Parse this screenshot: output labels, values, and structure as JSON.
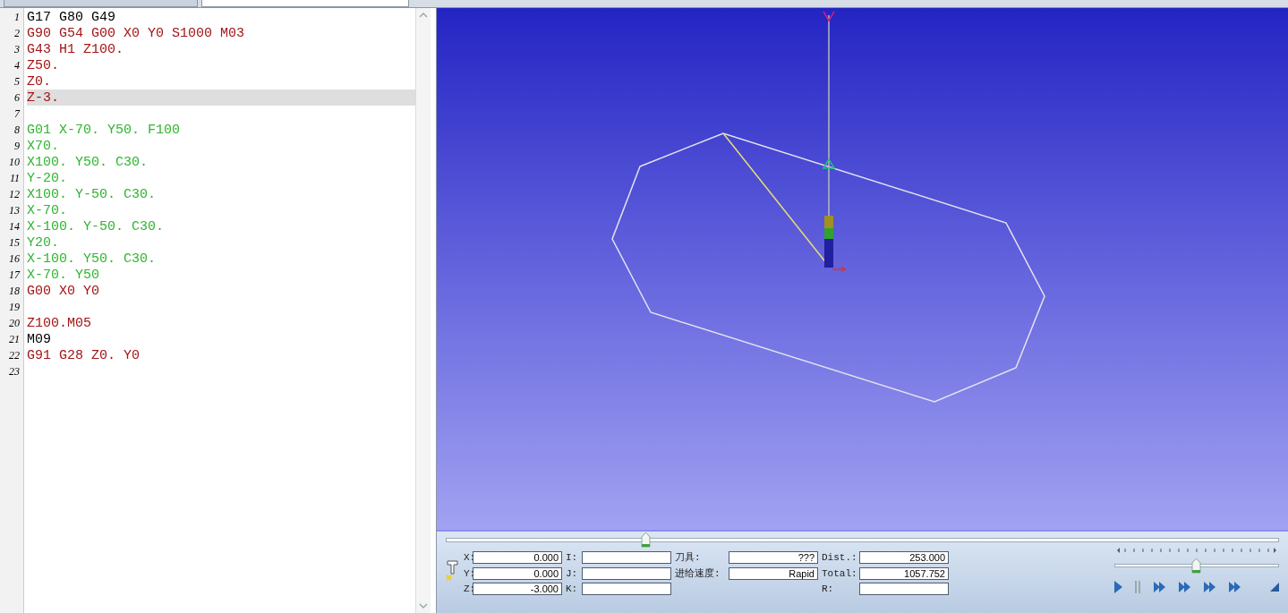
{
  "editor": {
    "lines": [
      {
        "number": "1",
        "text": "G17 G80 G49",
        "kind": "plain",
        "selected": false
      },
      {
        "number": "2",
        "text": "G90 G54 G00 X0 Y0 S1000 M03",
        "kind": "rapid",
        "selected": false
      },
      {
        "number": "3",
        "text": "G43 H1 Z100.",
        "kind": "rapid",
        "selected": false
      },
      {
        "number": "4",
        "text": "Z50.",
        "kind": "rapid",
        "selected": false
      },
      {
        "number": "5",
        "text": "Z0.",
        "kind": "rapid",
        "selected": false
      },
      {
        "number": "6",
        "text": "Z-3.",
        "kind": "rapid",
        "selected": true
      },
      {
        "number": "7",
        "kind": "plain",
        "selected": false
      },
      {
        "number": "8",
        "text": "G01 X-70. Y50. F100",
        "kind": "feed",
        "selected": false
      },
      {
        "number": "9",
        "text": "X70.",
        "kind": "feed",
        "selected": false
      },
      {
        "number": "10",
        "text": "X100. Y50. C30.",
        "kind": "feed",
        "selected": false
      },
      {
        "number": "11",
        "text": "Y-20.",
        "kind": "feed",
        "selected": false
      },
      {
        "number": "12",
        "text": "X100. Y-50. C30.",
        "kind": "feed",
        "selected": false
      },
      {
        "number": "13",
        "text": "X-70.",
        "kind": "feed",
        "selected": false
      },
      {
        "number": "14",
        "text": "X-100. Y-50. C30.",
        "kind": "feed",
        "selected": false
      },
      {
        "number": "15",
        "text": "Y20.",
        "kind": "feed",
        "selected": false
      },
      {
        "number": "16",
        "text": "X-100. Y50. C30.",
        "kind": "feed",
        "selected": false
      },
      {
        "number": "17",
        "text": "X-70. Y50",
        "kind": "feed",
        "selected": false
      },
      {
        "number": "18",
        "text": "G00 X0 Y0",
        "kind": "rapid",
        "selected": false
      },
      {
        "number": "19",
        "kind": "plain",
        "selected": false
      },
      {
        "number": "20",
        "text": "Z100.M05",
        "kind": "rapid",
        "selected": false
      },
      {
        "number": "21",
        "text": "M09",
        "kind": "plain",
        "selected": false
      },
      {
        "number": "22",
        "text": "G91 G28 Z0. Y0",
        "kind": "rapid",
        "selected": false
      },
      {
        "number": "23",
        "kind": "plain",
        "selected": false
      }
    ]
  },
  "timeline": {
    "level": 0.24
  },
  "readouts": [
    {
      "label": "X:",
      "value": "0.000"
    },
    {
      "label": "I:"
    },
    {
      "label": "刀具:",
      "value": "???"
    },
    {
      "label": "Dist.:",
      "value": "253.000"
    },
    {
      "label": "Y:",
      "value": "0.000"
    },
    {
      "label": "J:"
    },
    {
      "label": "进给速度:",
      "value": "Rapid"
    },
    {
      "label": "Total:",
      "value": "1057.752"
    },
    {
      "label": "Z:",
      "value": "-3.000"
    },
    {
      "label": "K:"
    },
    {
      "label": "R:"
    }
  ],
  "speed": {
    "level": 0.5
  }
}
